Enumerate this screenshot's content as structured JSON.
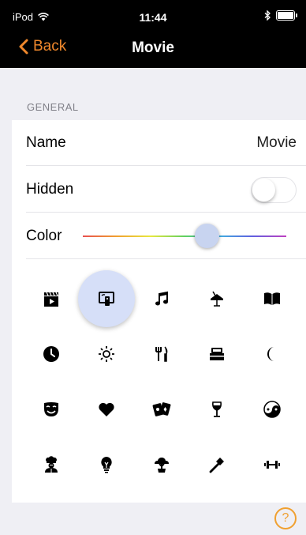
{
  "status": {
    "carrier": "iPod",
    "time": "11:44"
  },
  "nav": {
    "back_label": "Back",
    "title": "Movie"
  },
  "section": {
    "general": "GENERAL"
  },
  "rows": {
    "name_label": "Name",
    "name_value": "Movie",
    "hidden_label": "Hidden",
    "hidden_on": false,
    "color_label": "Color",
    "color_level": 0.61
  },
  "icons": [
    "clapperboard-icon",
    "remote-icon",
    "music-note-icon",
    "lamp-icon",
    "book-icon",
    "clock-icon",
    "sun-icon",
    "fork-knife-icon",
    "bed-icon",
    "moon-icon",
    "mask-icon",
    "heart-icon",
    "cards-icon",
    "wine-glass-icon",
    "yin-yang-icon",
    "chef-icon",
    "lightbulb-icon",
    "tree-icon",
    "hammer-icon",
    "dumbbell-icon"
  ],
  "selected_icon": "remote-icon",
  "accent_color": "#f0882c"
}
